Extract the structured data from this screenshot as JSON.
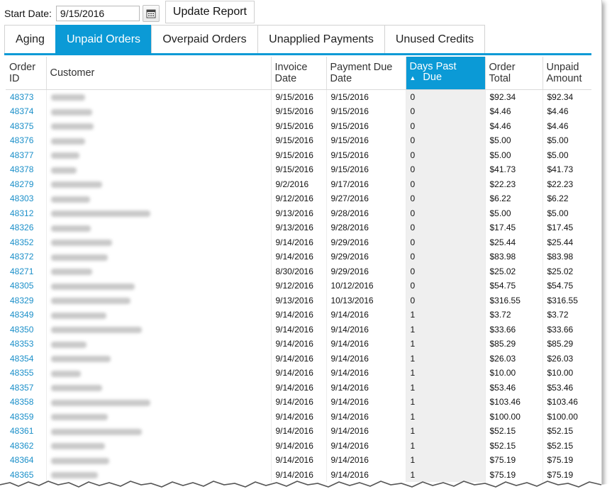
{
  "toolbar": {
    "start_label": "Start Date:",
    "start_value": "9/15/2016",
    "update_label": "Update Report"
  },
  "tabs": [
    {
      "label": "Aging",
      "active": false
    },
    {
      "label": "Unpaid Orders",
      "active": true
    },
    {
      "label": "Overpaid Orders",
      "active": false
    },
    {
      "label": "Unapplied Payments",
      "active": false
    },
    {
      "label": "Unused Credits",
      "active": false
    }
  ],
  "columns": {
    "order_id": [
      "Order",
      "ID"
    ],
    "customer": "Customer",
    "invoice_date": [
      "Invoice",
      "Date"
    ],
    "payment_due": [
      "Payment Due",
      "Date"
    ],
    "days_past_due": [
      "Days Past",
      "Due"
    ],
    "order_total": [
      "Order",
      "Total"
    ],
    "unpaid_amount": [
      "Unpaid",
      "Amount"
    ]
  },
  "colors": {
    "accent": "#0b9ad6",
    "link": "#1a8fc9"
  },
  "rows": [
    {
      "id": "48373",
      "invoice": "9/15/2016",
      "due": "9/15/2016",
      "days": "0",
      "total": "$92.34",
      "unpaid": "$92.34"
    },
    {
      "id": "48374",
      "invoice": "9/15/2016",
      "due": "9/15/2016",
      "days": "0",
      "total": "$4.46",
      "unpaid": "$4.46"
    },
    {
      "id": "48375",
      "invoice": "9/15/2016",
      "due": "9/15/2016",
      "days": "0",
      "total": "$4.46",
      "unpaid": "$4.46"
    },
    {
      "id": "48376",
      "invoice": "9/15/2016",
      "due": "9/15/2016",
      "days": "0",
      "total": "$5.00",
      "unpaid": "$5.00"
    },
    {
      "id": "48377",
      "invoice": "9/15/2016",
      "due": "9/15/2016",
      "days": "0",
      "total": "$5.00",
      "unpaid": "$5.00"
    },
    {
      "id": "48378",
      "invoice": "9/15/2016",
      "due": "9/15/2016",
      "days": "0",
      "total": "$41.73",
      "unpaid": "$41.73"
    },
    {
      "id": "48279",
      "invoice": "9/2/2016",
      "due": "9/17/2016",
      "days": "0",
      "total": "$22.23",
      "unpaid": "$22.23"
    },
    {
      "id": "48303",
      "invoice": "9/12/2016",
      "due": "9/27/2016",
      "days": "0",
      "total": "$6.22",
      "unpaid": "$6.22"
    },
    {
      "id": "48312",
      "invoice": "9/13/2016",
      "due": "9/28/2016",
      "days": "0",
      "total": "$5.00",
      "unpaid": "$5.00"
    },
    {
      "id": "48326",
      "invoice": "9/13/2016",
      "due": "9/28/2016",
      "days": "0",
      "total": "$17.45",
      "unpaid": "$17.45"
    },
    {
      "id": "48352",
      "invoice": "9/14/2016",
      "due": "9/29/2016",
      "days": "0",
      "total": "$25.44",
      "unpaid": "$25.44"
    },
    {
      "id": "48372",
      "invoice": "9/14/2016",
      "due": "9/29/2016",
      "days": "0",
      "total": "$83.98",
      "unpaid": "$83.98"
    },
    {
      "id": "48271",
      "invoice": "8/30/2016",
      "due": "9/29/2016",
      "days": "0",
      "total": "$25.02",
      "unpaid": "$25.02"
    },
    {
      "id": "48305",
      "invoice": "9/12/2016",
      "due": "10/12/2016",
      "days": "0",
      "total": "$54.75",
      "unpaid": "$54.75"
    },
    {
      "id": "48329",
      "invoice": "9/13/2016",
      "due": "10/13/2016",
      "days": "0",
      "total": "$316.55",
      "unpaid": "$316.55"
    },
    {
      "id": "48349",
      "invoice": "9/14/2016",
      "due": "9/14/2016",
      "days": "1",
      "total": "$3.72",
      "unpaid": "$3.72"
    },
    {
      "id": "48350",
      "invoice": "9/14/2016",
      "due": "9/14/2016",
      "days": "1",
      "total": "$33.66",
      "unpaid": "$33.66"
    },
    {
      "id": "48353",
      "invoice": "9/14/2016",
      "due": "9/14/2016",
      "days": "1",
      "total": "$85.29",
      "unpaid": "$85.29"
    },
    {
      "id": "48354",
      "invoice": "9/14/2016",
      "due": "9/14/2016",
      "days": "1",
      "total": "$26.03",
      "unpaid": "$26.03"
    },
    {
      "id": "48355",
      "invoice": "9/14/2016",
      "due": "9/14/2016",
      "days": "1",
      "total": "$10.00",
      "unpaid": "$10.00"
    },
    {
      "id": "48357",
      "invoice": "9/14/2016",
      "due": "9/14/2016",
      "days": "1",
      "total": "$53.46",
      "unpaid": "$53.46"
    },
    {
      "id": "48358",
      "invoice": "9/14/2016",
      "due": "9/14/2016",
      "days": "1",
      "total": "$103.46",
      "unpaid": "$103.46"
    },
    {
      "id": "48359",
      "invoice": "9/14/2016",
      "due": "9/14/2016",
      "days": "1",
      "total": "$100.00",
      "unpaid": "$100.00"
    },
    {
      "id": "48361",
      "invoice": "9/14/2016",
      "due": "9/14/2016",
      "days": "1",
      "total": "$52.15",
      "unpaid": "$52.15"
    },
    {
      "id": "48362",
      "invoice": "9/14/2016",
      "due": "9/14/2016",
      "days": "1",
      "total": "$52.15",
      "unpaid": "$52.15"
    },
    {
      "id": "48364",
      "invoice": "9/14/2016",
      "due": "9/14/2016",
      "days": "1",
      "total": "$75.19",
      "unpaid": "$75.19"
    },
    {
      "id": "48365",
      "invoice": "9/14/2016",
      "due": "9/14/2016",
      "days": "1",
      "total": "$75.19",
      "unpaid": "$75.19"
    }
  ]
}
